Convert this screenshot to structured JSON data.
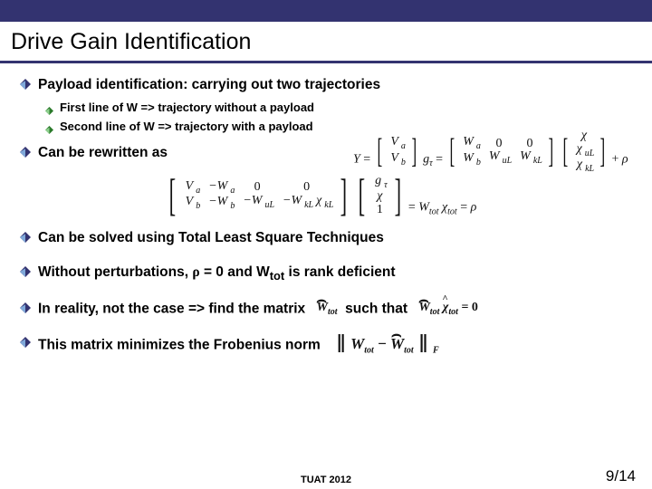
{
  "title": "Drive Gain Identification",
  "b1": "Payload identification: carrying out two trajectories",
  "s1": "First line of W => trajectory without a payload",
  "s2": "Second line of W => trajectory with a payload",
  "b2": "Can be rewritten as",
  "b3": "Can be solved using Total Least Square Techniques",
  "b4_pre": "Without perturbations, ",
  "b4_rho": "ρ",
  "b4_mid": " = 0 and W",
  "b4_sub": "tot",
  "b4_post": " is rank deficient",
  "b5_pre": "In reality, not the case => find the matrix",
  "b5_post": "such that",
  "b6": "This matrix minimizes the Frobenius norm",
  "footer": "TUAT 2012",
  "page": "9/14",
  "eq1": {
    "Y": "Y",
    "eq": "=",
    "Va": "V",
    "Va_s": "a",
    "Vb": "V",
    "Vb_s": "b",
    "g": "g",
    "g_s": "τ",
    "Wa": "W",
    "Wa_s": "a",
    "z1": "0",
    "z2": "0",
    "Wb": "W",
    "Wb_s": "b",
    "WuL": "W",
    "WuL_s": "uL",
    "WkL": "W",
    "WkL_s": "kL",
    "chi": "χ",
    "chiu": "χ",
    "chiu_s": "uL",
    "chik": "χ",
    "chik_s": "kL",
    "plus": "+",
    "rho": "ρ"
  },
  "eq2": {
    "Va": "V",
    "Va_s": "a",
    "mWa": "−W",
    "mWa_s": "a",
    "z1": "0",
    "z2": "0",
    "Vb": "V",
    "Vb_s": "b",
    "mWb": "−W",
    "mWb_s": "b",
    "mWuL": "−W",
    "mWuL_s": "uL",
    "mWkLchi": "−W",
    "mWkL_s": "kL",
    "chikL": "χ",
    "chikL_s": "kL",
    "g": "g",
    "g_s": "τ",
    "chi": "χ",
    "one": "1",
    "eq": "=",
    "Wtot": "W",
    "Wtot_s": "tot",
    "chitot": "χ",
    "chitot_s": "tot",
    "rho": "ρ"
  },
  "eq3": {
    "W": "W",
    "W_s": "tot"
  },
  "eq4": {
    "W": "W",
    "W_s": "tot",
    "chi": "χ",
    "chi_s": "tot",
    "eq": "= 0"
  },
  "eq5": {
    "W": "W",
    "W_s": "tot",
    "minus": " − ",
    "Wh": "W",
    "Wh_s": "tot",
    "F": "F"
  }
}
